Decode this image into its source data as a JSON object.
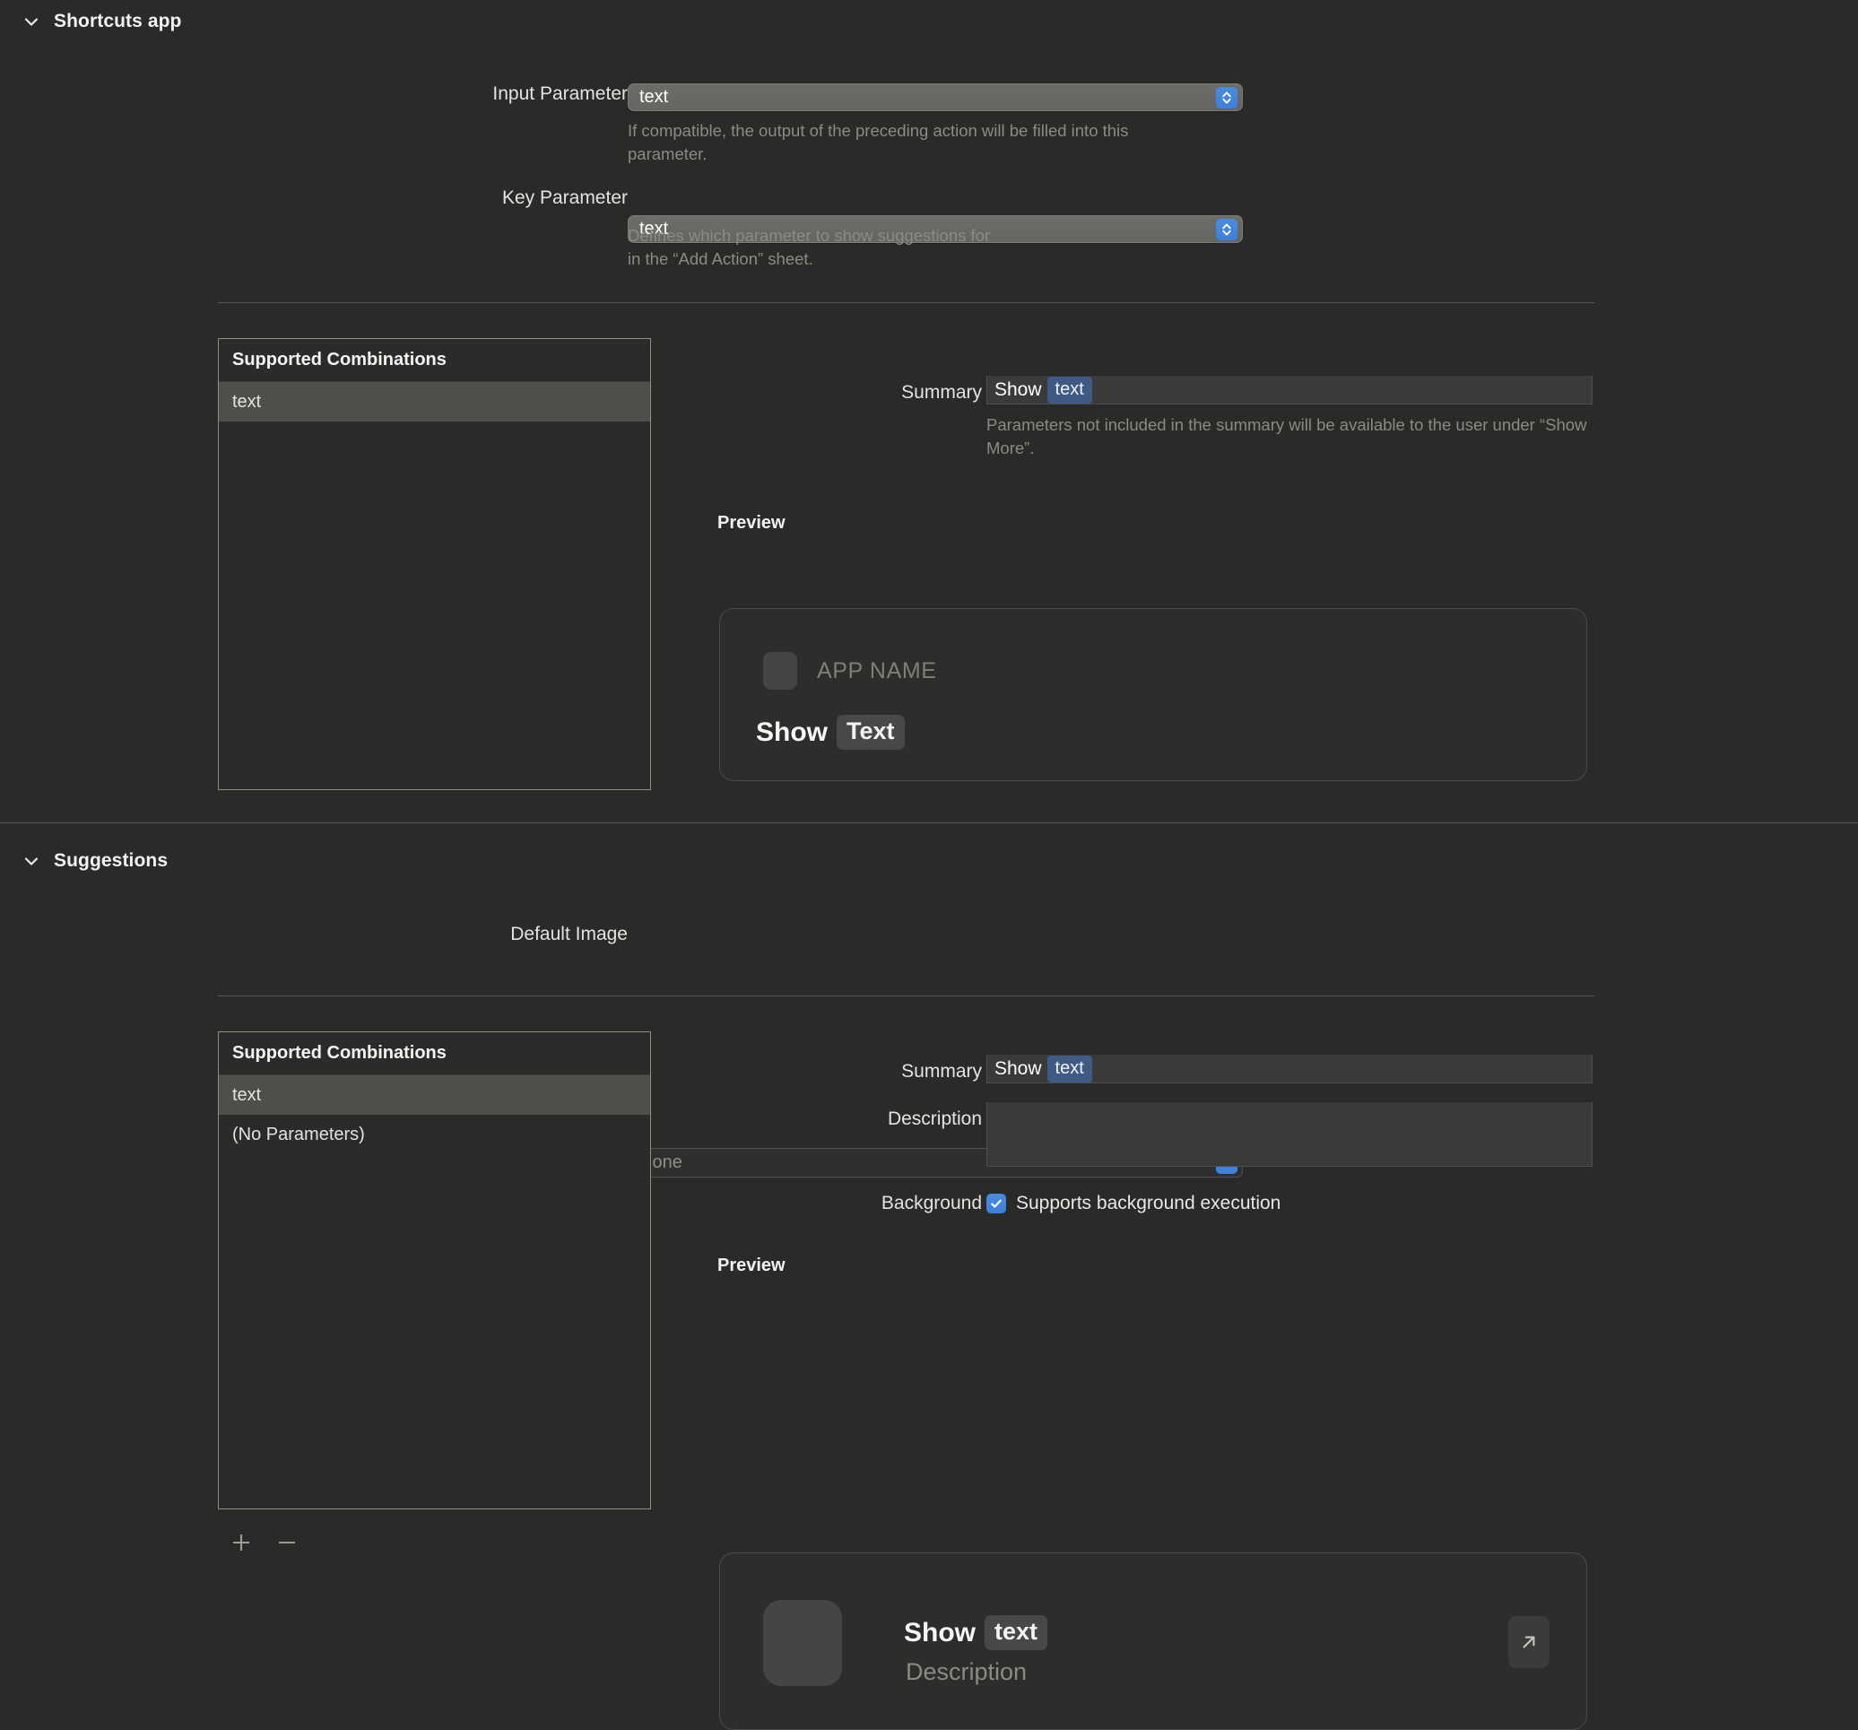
{
  "shortcuts_section": {
    "title": "Shortcuts app",
    "disclosure_icon": "chevron-down-icon",
    "input_parameter": {
      "label": "Input Parameter",
      "value": "text",
      "help": "If compatible, the output of the preceding action will be filled into this parameter.",
      "stepper_icon": "chevron-up-down-icon"
    },
    "key_parameter": {
      "label": "Key Parameter",
      "value": "text",
      "help": "Defines which parameter to show suggestions for\nin the “Add Action” sheet.",
      "stepper_icon": "chevron-up-down-icon"
    },
    "combinations": {
      "header": "Supported Combinations",
      "rows": [
        {
          "label": "text",
          "selected": true
        }
      ]
    },
    "summary": {
      "label": "Summary",
      "prefix": "Show",
      "token": "text",
      "help": "Parameters not included in the summary will be available to the user under “Show More”."
    },
    "preview": {
      "title": "Preview",
      "app_icon": "app-icon-placeholder",
      "app_name": "APP NAME",
      "action_prefix": "Show",
      "action_token": "Text"
    }
  },
  "suggestions_section": {
    "title": "Suggestions",
    "disclosure_icon": "chevron-down-icon",
    "default_image": {
      "label": "Default Image",
      "placeholder": "None",
      "menu_icon": "chevron-down-icon"
    },
    "combinations": {
      "header": "Supported Combinations",
      "rows": [
        {
          "label": "text",
          "selected": true
        },
        {
          "label": "(No Parameters)",
          "selected": false
        }
      ]
    },
    "summary": {
      "label": "Summary",
      "prefix": "Show",
      "token": "text"
    },
    "description": {
      "label": "Description",
      "value": ""
    },
    "background": {
      "label": "Background",
      "checkbox_label": "Supports background execution",
      "checked": true,
      "check_icon": "checkmark-icon"
    },
    "preview": {
      "title": "Preview",
      "app_icon": "app-icon-placeholder",
      "action_prefix": "Show",
      "action_token": "text",
      "description": "Description",
      "open_icon": "arrow-up-right-icon"
    },
    "list_controls": {
      "add_label": "+",
      "add_icon": "plus-icon",
      "remove_label": "−",
      "remove_icon": "minus-icon"
    }
  },
  "colors": {
    "background": "#2a2a28",
    "accent_blue": "#3d7fdc",
    "token_blue": "#3f5a85",
    "selection_gray": "#4e4e4b",
    "help_text": "#8a8a87"
  }
}
